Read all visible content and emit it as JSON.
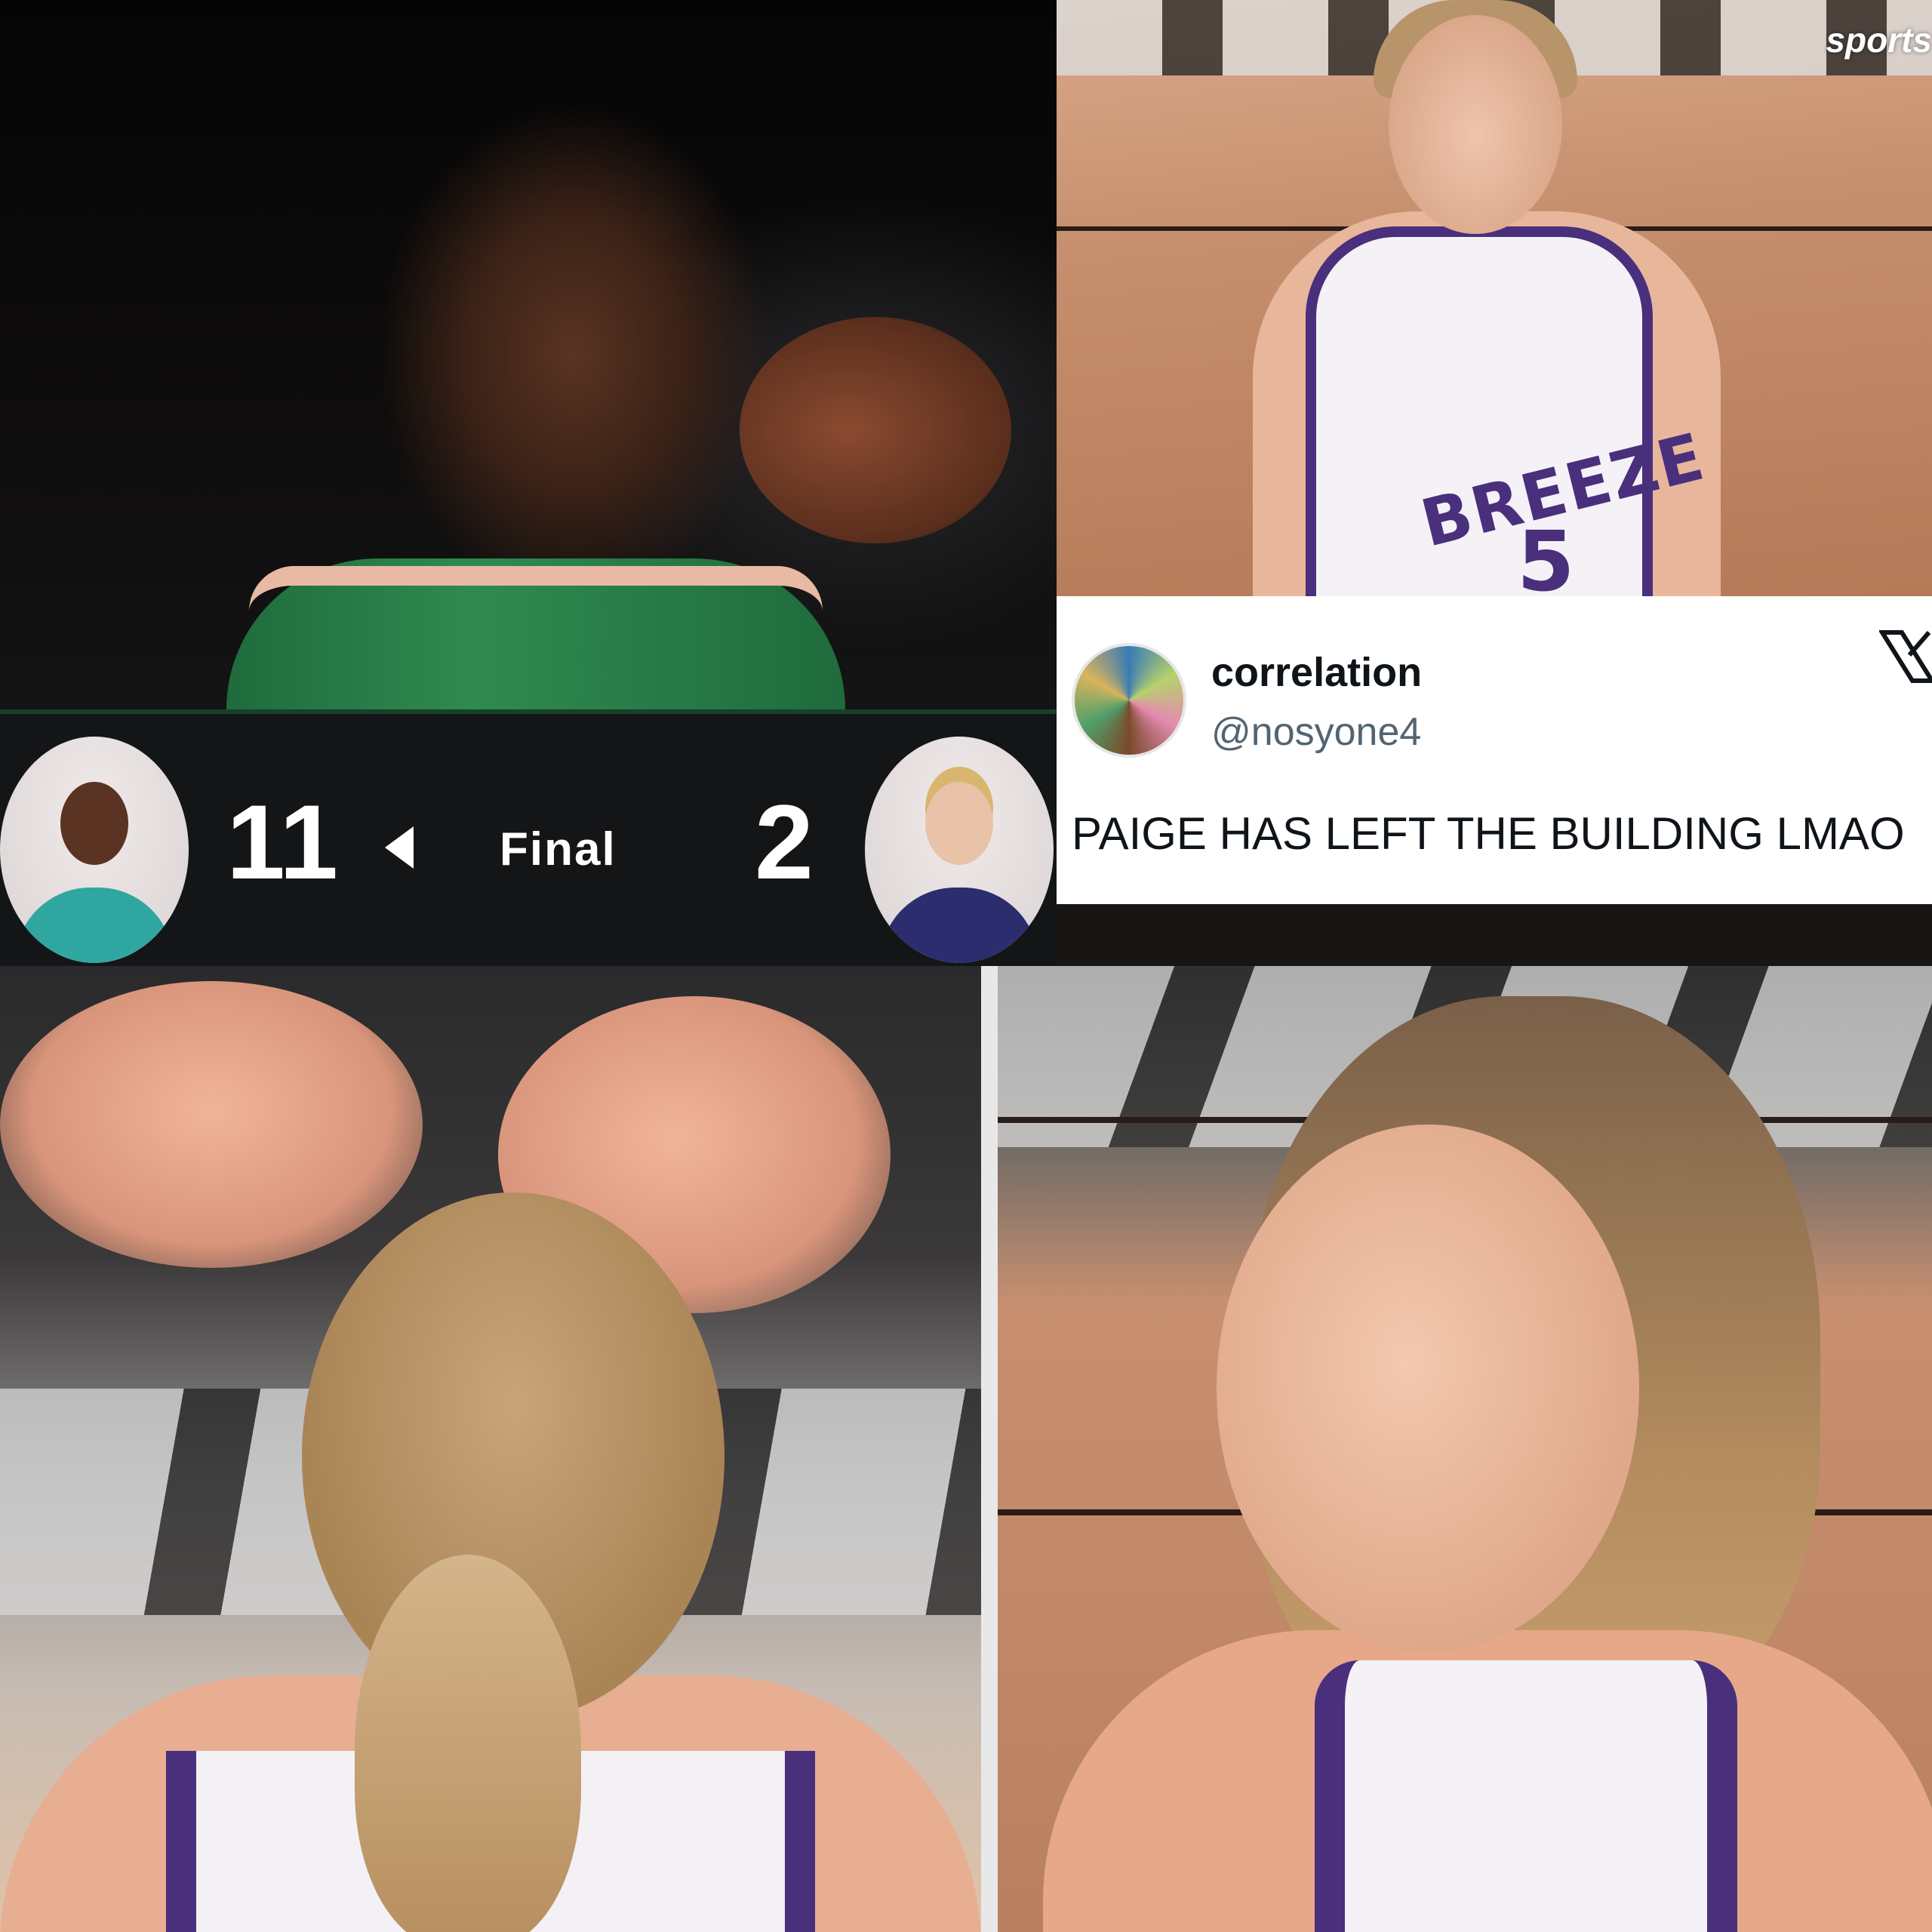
{
  "scoreboard": {
    "home_score": "11",
    "away_score": "2",
    "status": "Final"
  },
  "top_right_photo": {
    "watermark": "sports",
    "jersey_team": "BREEZE",
    "jersey_number": "5"
  },
  "tweet": {
    "name": "correlation",
    "handle": "@nosyone4",
    "text": "PAIGE HAS LEFT THE BUILDING LMAO",
    "platform_icon": "x-logo-icon"
  },
  "colors": {
    "scoreboard_bg": "#141516",
    "team_green": "#2f8a50",
    "breeze_purple": "#4a2f7c",
    "tweet_bg": "#ffffff"
  }
}
